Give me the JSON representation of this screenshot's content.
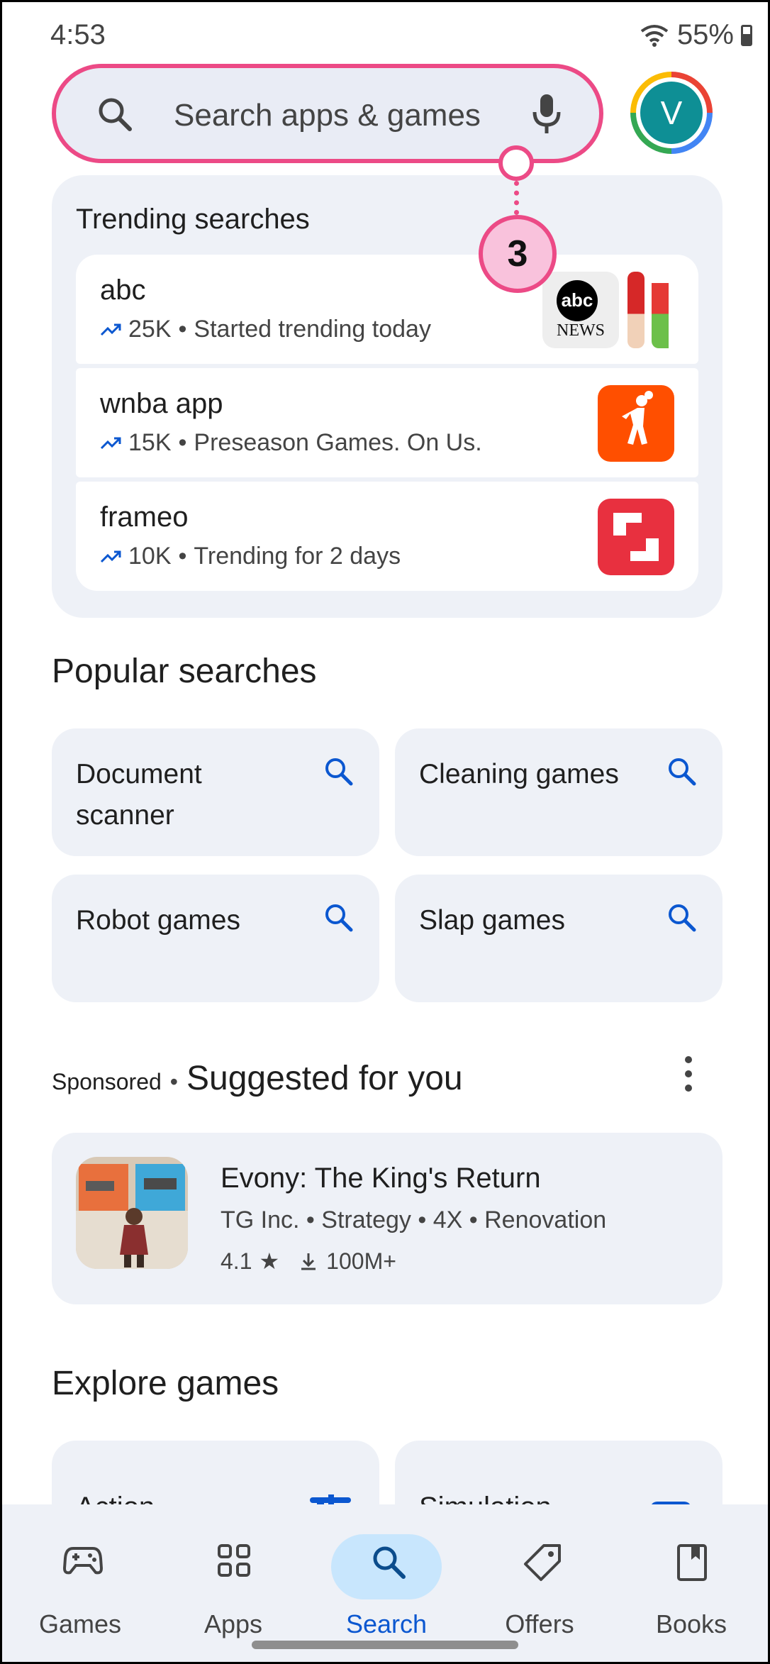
{
  "status_bar": {
    "time": "4:53",
    "battery": "55%"
  },
  "search": {
    "placeholder": "Search apps & games",
    "avatar_letter": "V"
  },
  "annotation": {
    "step": "3"
  },
  "trending": {
    "title": "Trending searches",
    "items": [
      {
        "name": "abc",
        "count": "25K",
        "detail": "Started trending today"
      },
      {
        "name": "wnba app",
        "count": "15K",
        "detail": "Preseason Games. On Us."
      },
      {
        "name": "frameo",
        "count": "10K",
        "detail": "Trending for 2 days"
      }
    ],
    "abc_logo_text": "abc",
    "abc_logo_sub": "NEWS"
  },
  "popular": {
    "title": "Popular searches",
    "items": [
      {
        "label": "Document scanner"
      },
      {
        "label": "Cleaning games"
      },
      {
        "label": "Robot games"
      },
      {
        "label": "Slap games"
      }
    ]
  },
  "suggested": {
    "sponsored": "Sponsored",
    "title": "Suggested for you",
    "app": {
      "name": "Evony: The King's Return",
      "developer": "TG Inc.",
      "tags": [
        "Strategy",
        "4X",
        "Renovation"
      ],
      "rating": "4.1",
      "downloads": "100M+"
    }
  },
  "explore": {
    "title": "Explore games",
    "cards": [
      {
        "label": "Action"
      },
      {
        "label": "Simulation"
      }
    ]
  },
  "nav": {
    "items": [
      {
        "label": "Games",
        "icon": "gamepad-icon"
      },
      {
        "label": "Apps",
        "icon": "apps-grid-icon"
      },
      {
        "label": "Search",
        "icon": "search-icon",
        "active": true
      },
      {
        "label": "Offers",
        "icon": "tag-icon"
      },
      {
        "label": "Books",
        "icon": "book-icon"
      }
    ]
  },
  "colors": {
    "accent": "#0b57d0",
    "highlight": "#ec4a86",
    "card": "#eef1f7"
  }
}
